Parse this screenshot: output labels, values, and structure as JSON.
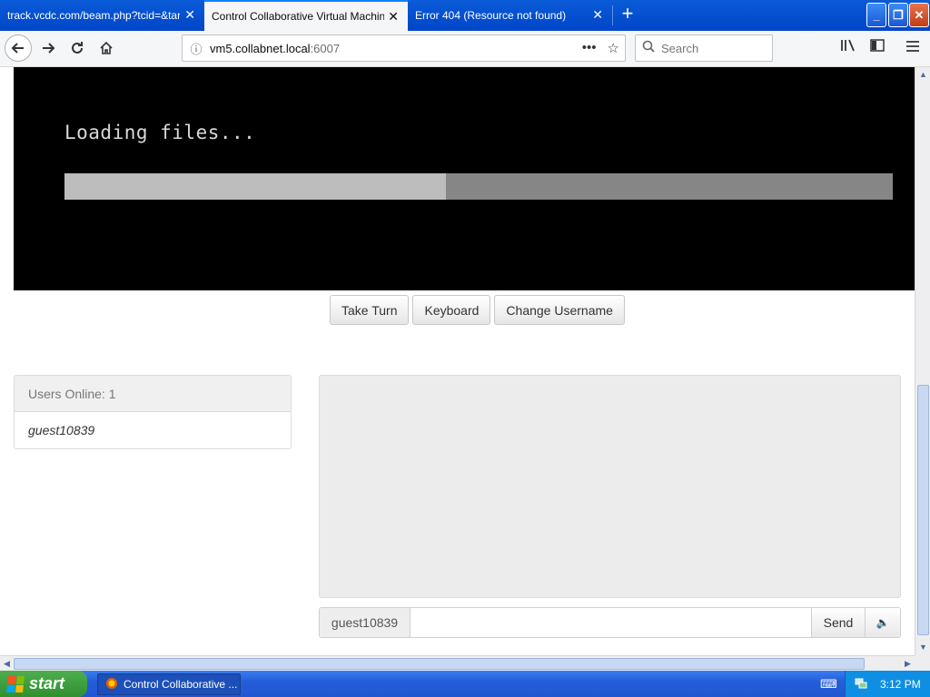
{
  "browser": {
    "tabs": [
      {
        "title": "track.vcdc.com/beam.php?tcid=&targ",
        "active": false
      },
      {
        "title": "Control Collaborative Virtual Machines!",
        "active": true
      },
      {
        "title": "Error 404 (Resource not found)",
        "active": false
      }
    ],
    "close_glyph": "✕",
    "new_tab_glyph": "+",
    "url": {
      "host": "vm5.collabnet.local",
      "port": ":6007"
    },
    "search_placeholder": "Search",
    "window_buttons": {
      "minimize": "_",
      "maximize": "❐",
      "close": "✕"
    }
  },
  "vm": {
    "loading_text": "Loading files...",
    "progress_fraction": 0.46
  },
  "controls": {
    "take_turn": "Take Turn",
    "keyboard": "Keyboard",
    "change_username": "Change Username"
  },
  "users": {
    "header": "Users Online: 1",
    "list": [
      "guest10839"
    ]
  },
  "chat": {
    "username": "guest10839",
    "message_value": "",
    "send_label": "Send",
    "sound_icon": "🔈"
  },
  "taskbar": {
    "start_label": "start",
    "window_item": "Control Collaborative ...",
    "clock": "3:12 PM"
  }
}
